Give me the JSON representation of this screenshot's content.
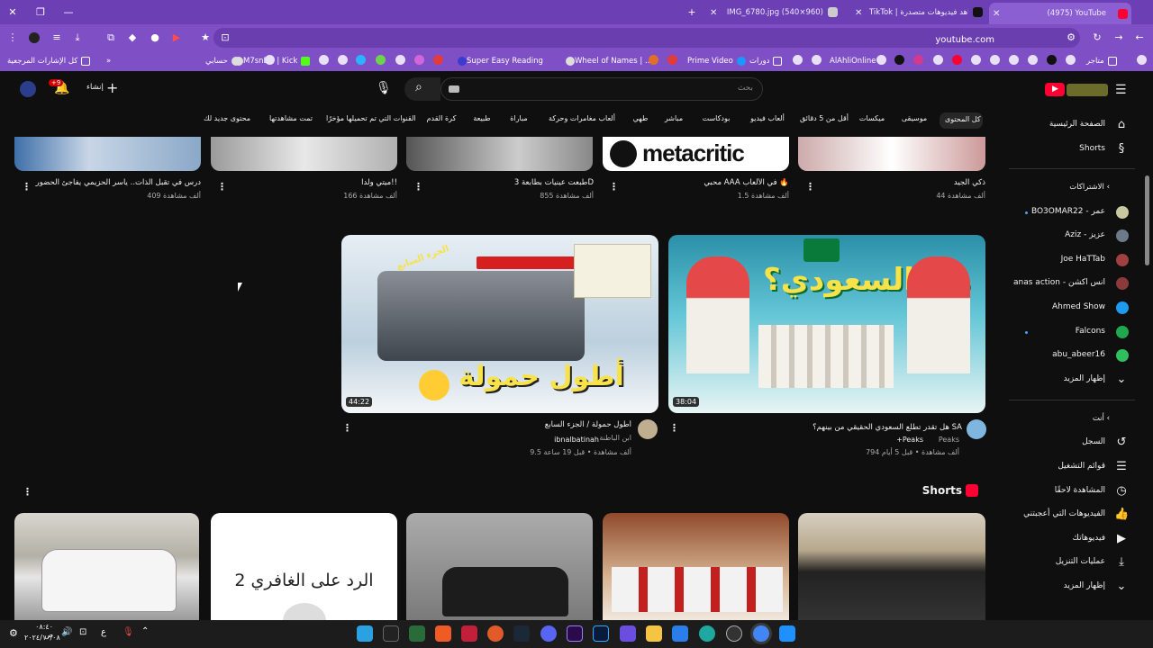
{
  "browser": {
    "tabs": [
      {
        "title": "(4975) YouTube",
        "active": true
      },
      {
        "title": "TikTok | شاهد فيديوهات متصدرة",
        "active": false
      },
      {
        "title": "IMG_6780.jpg (540×960)",
        "active": false
      }
    ],
    "url": "youtube.com",
    "bookmarks": [
      "كل الإشارات المرجعية",
      "حسابي",
      "M7snEQ | Kick",
      "Super Easy Reading",
      "Wheel of Names | ...",
      "Prime Video",
      "دورات",
      "AlAhliOnline",
      "متاجر"
    ]
  },
  "header": {
    "search_placeholder": "بحث",
    "create_label": "إنشاء",
    "notifications_badge": "+9"
  },
  "chips": [
    "كل المحتوى",
    "موسيقى",
    "ميكسات",
    "أقل من 5 دقائق",
    "ألعاب فيديو",
    "بودكاست",
    "مباشر",
    "طهي",
    "ألعاب مغامرات وحركة",
    "مباراة",
    "طبيعة",
    "كرة القدم",
    "القنوات التي تم تحميلها مؤخرًا",
    "تمت مشاهدتها",
    "محتوى جديد لك"
  ],
  "top_row": [
    {
      "title": "ذكي الجيد",
      "views": "44 ألف مشاهدة"
    },
    {
      "title": "محبي AAA في الألعاب 🔥",
      "views": "1.5 ألف مشاهدة"
    },
    {
      "title": "طبعت عينيات بطابعة 3D",
      "views": "855 ألف مشاهدة"
    },
    {
      "title": "ميتي ولدا!!",
      "views": "166 ألف مشاهدة"
    },
    {
      "title": "درس في تقبل الذات.. ياسر الحزيمي يفاجئ الحضور",
      "views": "409 ألف مشاهدة"
    }
  ],
  "videos": [
    {
      "title": "هل تقدر تطلع السعودي الحقيقي من بينهم؟ SA",
      "channel": "Peaks",
      "channel_extra": "+Peaks",
      "stats": "794 ألف مشاهدة • قبل 5 أيام",
      "duration": "38:04"
    },
    {
      "title": "أطول حمولة / الجزء السابع",
      "channel": "ابن الباطنة",
      "handle": "ibnalbatinah",
      "stats": "9.5 ألف مشاهدة • قبل 19 ساعة",
      "duration": "44:22"
    }
  ],
  "shorts_title": "Shorts",
  "shorts_caption": "الرد على الغافري 2",
  "sidebar": {
    "home": "الصفحة الرئيسية",
    "shorts": "Shorts",
    "subs_title": "الاشتراكات",
    "subs": [
      "BO3OMAR22 - عمر",
      "Aziz - عزيز",
      "Joe HaTTab",
      "anas action - انس اكشن",
      "Ahmed Show",
      "Falcons",
      "abu_abeer16"
    ],
    "show_more": "إظهار المزيد",
    "you_title": "أنت",
    "you_items": [
      "السجل",
      "قوائم التشغيل",
      "المشاهدة لاحقًا",
      "الفيديوهات التي أعجبتني",
      "فيديوهاتك",
      "عمليات التنزيل",
      "إظهار المزيد"
    ]
  },
  "taskbar": {
    "time": "٠٨:٤٠ ص",
    "date": "٢٠٢٤/١٠/٠٨",
    "lang": "ع"
  },
  "thumb_texts": {
    "metacritic": "metacritic",
    "man_alsaudi": "من السعودي؟",
    "atwal_humula": "أطول حمولة",
    "part7": "الجزء السابع"
  },
  "colors": {
    "browser": "#7f4fc6",
    "tabbar": "#6c3fb4",
    "bg": "#0f0f0f",
    "yt_red": "#ff0033"
  }
}
